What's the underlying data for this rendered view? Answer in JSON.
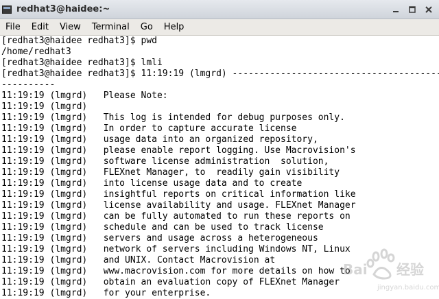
{
  "window": {
    "title": "redhat3@haidee:~",
    "buttons": [
      "minimize",
      "maximize",
      "close"
    ]
  },
  "menubar": {
    "items": [
      "File",
      "Edit",
      "View",
      "Terminal",
      "Go",
      "Help"
    ]
  },
  "terminal": {
    "lines": [
      "[redhat3@haidee redhat3]$ pwd",
      "/home/redhat3",
      "[redhat3@haidee redhat3]$ lmli",
      "[redhat3@haidee redhat3]$ 11:19:19 (lmgrd) --------------------------------------------",
      "----------",
      "11:19:19 (lmgrd)   Please Note:",
      "11:19:19 (lmgrd)",
      "11:19:19 (lmgrd)   This log is intended for debug purposes only.",
      "11:19:19 (lmgrd)   In order to capture accurate license",
      "11:19:19 (lmgrd)   usage data into an organized repository,",
      "11:19:19 (lmgrd)   please enable report logging. Use Macrovision's",
      "11:19:19 (lmgrd)   software license administration  solution,",
      "11:19:19 (lmgrd)   FLEXnet Manager, to  readily gain visibility",
      "11:19:19 (lmgrd)   into license usage data and to create",
      "11:19:19 (lmgrd)   insightful reports on critical information like",
      "11:19:19 (lmgrd)   license availability and usage. FLEXnet Manager",
      "11:19:19 (lmgrd)   can be fully automated to run these reports on",
      "11:19:19 (lmgrd)   schedule and can be used to track license",
      "11:19:19 (lmgrd)   servers and usage across a heterogeneous",
      "11:19:19 (lmgrd)   network of servers including Windows NT, Linux",
      "11:19:19 (lmgrd)   and UNIX. Contact Macrovision at",
      "11:19:19 (lmgrd)   www.macrovision.com for more details on how to",
      "11:19:19 (lmgrd)   obtain an evaluation copy of FLEXnet Manager",
      "11:19:19 (lmgrd)   for your enterprise."
    ]
  },
  "watermark": {
    "text": "Bai du 经验",
    "subtext": "jingyan.baidu.com"
  }
}
